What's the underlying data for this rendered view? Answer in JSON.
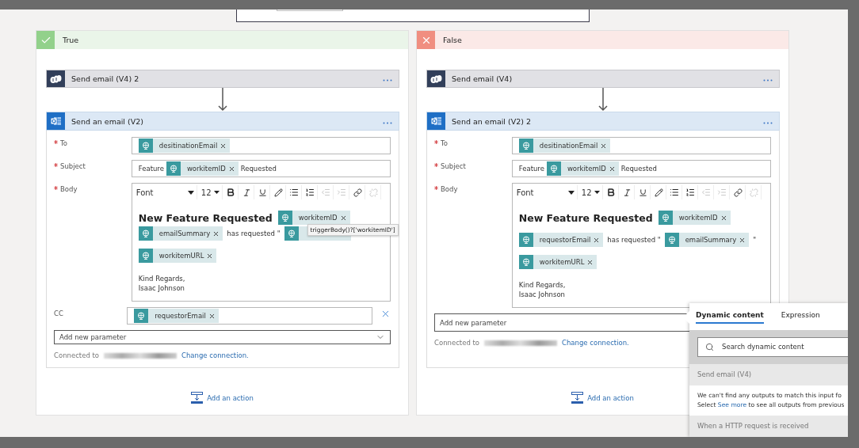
{
  "branches": [
    {
      "kind": "true",
      "title": "True",
      "first_action": {
        "title": "Send email (V4) 2"
      },
      "email_action": {
        "title": "Send an email (V2)",
        "fields": [
          {
            "label": "To",
            "required": true,
            "kind": "tokens",
            "content": [
              {
                "kind": "token",
                "label": "desitinationEmail"
              }
            ]
          },
          {
            "label": "Subject",
            "required": true,
            "kind": "tokens",
            "content": [
              {
                "kind": "text",
                "text": "Feature"
              },
              {
                "kind": "token",
                "label": "workitemID"
              },
              {
                "kind": "text",
                "text": "Requested"
              }
            ]
          },
          {
            "label": "Body",
            "required": true,
            "kind": "editor",
            "toolbar": {
              "font": "Font",
              "size": "12",
              "unlink_disabled": true
            },
            "paragraphs": [
              [
                {
                  "kind": "heading",
                  "text": "New Feature Requested"
                },
                {
                  "kind": "token",
                  "label": "workitemID"
                },
                {
                  "kind": "token",
                  "label": "emailSummary"
                },
                {
                  "kind": "text",
                  "text": "has requested \""
                },
                {
                  "kind": "covered_token",
                  "tooltip": "triggerBody()?['workitemID']"
                }
              ],
              [
                {
                  "kind": "token",
                  "label": "workitemURL"
                }
              ]
            ],
            "signature": [
              "Kind Regards,",
              "Isaac Johnson"
            ]
          },
          {
            "label": "CC",
            "required": false,
            "kind": "tokens",
            "clearable": true,
            "content": [
              {
                "kind": "token",
                "label": "requestorEmail"
              }
            ]
          }
        ],
        "add_parameter": {
          "label": "Add new parameter",
          "chevron_visible": true
        },
        "connected_label": "Connected to",
        "change_link": "Change connection."
      },
      "add_action": "Add an action"
    },
    {
      "kind": "false",
      "title": "False",
      "first_action": {
        "title": "Send email (V4)"
      },
      "email_action": {
        "title": "Send an email (V2) 2",
        "fields": [
          {
            "label": "To",
            "required": true,
            "kind": "tokens",
            "content": [
              {
                "kind": "token",
                "label": "desitinationEmail"
              }
            ]
          },
          {
            "label": "Subject",
            "required": true,
            "kind": "tokens",
            "content": [
              {
                "kind": "text",
                "text": "Feature"
              },
              {
                "kind": "token",
                "label": "workitemID"
              },
              {
                "kind": "text",
                "text": "Requested"
              }
            ]
          },
          {
            "label": "Body",
            "required": true,
            "kind": "editor",
            "toolbar": {
              "font": "Font",
              "size": "12",
              "unlink_disabled": true
            },
            "paragraphs": [
              [
                {
                  "kind": "heading",
                  "text": "New Feature Requested"
                },
                {
                  "kind": "token",
                  "label": "workitemID"
                }
              ],
              [
                {
                  "kind": "token",
                  "label": "requestorEmail"
                },
                {
                  "kind": "text",
                  "text": "has requested \""
                },
                {
                  "kind": "token",
                  "label": "emailSummary"
                },
                {
                  "kind": "text",
                  "text": "\""
                }
              ],
              [
                {
                  "kind": "token",
                  "label": "workitemURL"
                }
              ]
            ],
            "signature": [
              "Kind Regards,",
              "Isaac Johnson"
            ]
          }
        ],
        "add_parameter": {
          "label": "Add new parameter",
          "chevron_visible": false
        },
        "connected_label": "Connected to",
        "change_link": "Change connection."
      },
      "add_action": "Add an action"
    }
  ],
  "dynamic_panel": {
    "tabs": [
      {
        "label": "Dynamic content",
        "selected": true
      },
      {
        "label": "Expression",
        "selected": false
      }
    ],
    "search": {
      "placeholder": "Search dynamic content"
    },
    "sections": [
      {
        "title": "Send email (V4)",
        "message_line": "We can't find any outputs to match this input fo",
        "hint": {
          "before": "Select",
          "link": "See more",
          "after": "to see all outputs from previous"
        }
      },
      {
        "title": "When a HTTP request is received"
      }
    ]
  }
}
